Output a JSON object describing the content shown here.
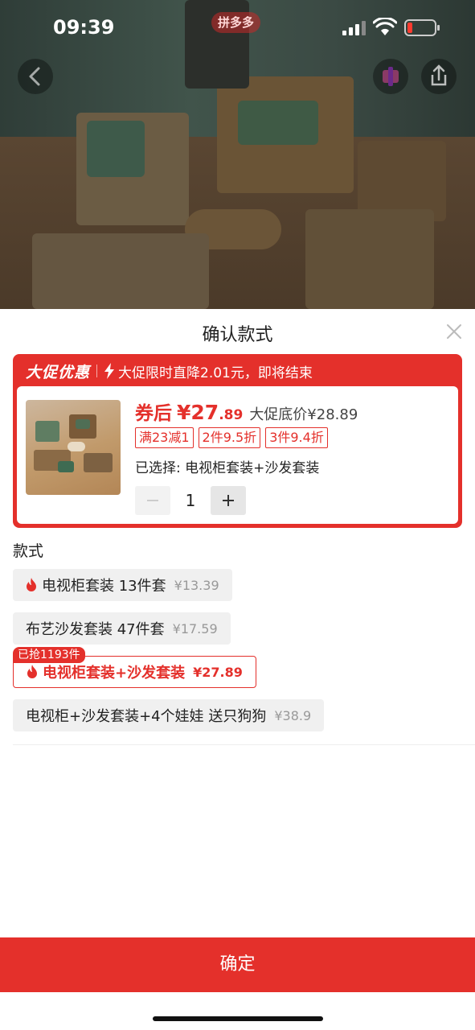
{
  "status_bar": {
    "time": "09:39",
    "app_logo": "拼多多"
  },
  "header_buttons": {
    "back_icon": "chevron-left-icon",
    "favorite_icon": "favorite-icon",
    "share_icon": "share-icon"
  },
  "sheet": {
    "title": "确认款式",
    "promo": {
      "badge": "大促优惠",
      "text": "大促限时直降2.01元，即将结束",
      "coupon_label": "券后",
      "price_main": "¥27",
      "price_decimal": ".89",
      "original_price": "大促底价¥28.89",
      "tags": [
        "满23减1",
        "2件9.5折",
        "3件9.4折"
      ],
      "selected_text": "已选择: 电视柜套装+沙发套装",
      "quantity": "1"
    },
    "section_title": "款式",
    "variants": [
      {
        "name": "电视柜套装 13件套",
        "price": "¥13.39",
        "hot": true
      },
      {
        "name": "布艺沙发套装 47件套",
        "price": "¥17.59",
        "hot": false
      },
      {
        "name": "电视柜套装+沙发套装",
        "price": "¥27.89",
        "hot": true,
        "sold_badge": "已抢1193件",
        "active": true
      },
      {
        "name": "电视柜+沙发套装+4个娃娃 送只狗狗",
        "price": "¥38.9",
        "hot": false
      }
    ],
    "confirm_label": "确定"
  },
  "colors": {
    "accent": "#e4302b",
    "muted_price": "#999999"
  }
}
